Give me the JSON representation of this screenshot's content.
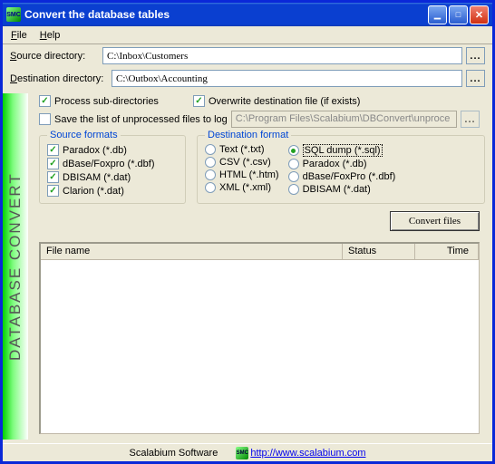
{
  "title": "Convert the database tables",
  "menu": {
    "file": "File",
    "help": "Help"
  },
  "paths": {
    "source_label_pre": "S",
    "source_label_post": "ource directory:",
    "source_value": "C:\\Inbox\\Customers",
    "dest_label_pre": "D",
    "dest_label_post": "estination directory:",
    "dest_value": "C:\\Outbox\\Accounting",
    "browse": "..."
  },
  "opts": {
    "process_sub": "Process sub-directories",
    "overwrite": "Overwrite destination file (if exists)",
    "save_log": "Save the list of unprocessed files to log",
    "log_path": "C:\\Program Files\\Scalabium\\DBConvert\\unproce"
  },
  "source_formats": {
    "title": "Source formats",
    "items": [
      "Paradox (*.db)",
      "dBase/Foxpro (*.dbf)",
      "DBISAM (*.dat)",
      "Clarion (*.dat)"
    ]
  },
  "dest_formats": {
    "title": "Destination format",
    "left": [
      "Text (*.txt)",
      "CSV (*.csv)",
      "HTML (*.htm)",
      "XML (*.xml)"
    ],
    "right": [
      "SQL dump (*.sql)",
      "Paradox (*.db)",
      "dBase/FoxPro (*.dbf)",
      "DBISAM (*.dat)"
    ]
  },
  "convert_label": "Convert files",
  "vstrip": "DATABASE CONVERT",
  "list": {
    "col1": "File name",
    "col2": "Status",
    "col3": "Time"
  },
  "status": {
    "company": "Scalabium Software",
    "url": "http://www.scalabium.com"
  }
}
